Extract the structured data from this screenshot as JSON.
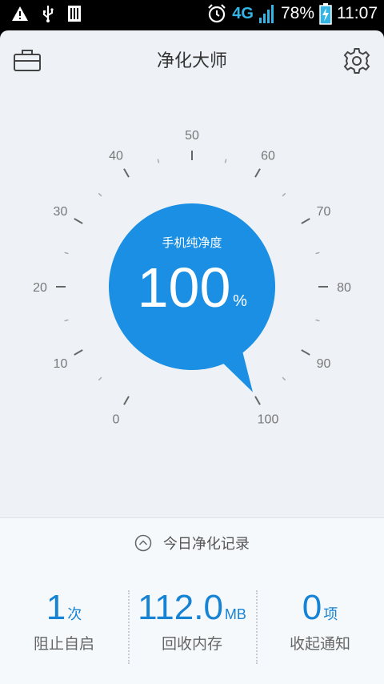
{
  "status_bar": {
    "network": "4G",
    "battery": "78%",
    "time": "11:07",
    "icons": [
      "warning-icon",
      "usb-icon",
      "sim-card-icon",
      "alarm-icon",
      "signal-icon",
      "battery-charging-icon"
    ]
  },
  "header": {
    "title": "净化大师",
    "left_icon": "briefcase-icon",
    "right_icon": "gear-icon"
  },
  "gauge": {
    "ticks": [
      "0",
      "10",
      "20",
      "30",
      "40",
      "50",
      "60",
      "70",
      "80",
      "90",
      "100"
    ],
    "label": "手机纯净度",
    "value": "100",
    "unit": "%",
    "level": 100,
    "accent": "#1a8fe3"
  },
  "today": {
    "label": "今日净化记录",
    "icon": "chevron-up-circle-icon"
  },
  "stats": [
    {
      "value": "1",
      "unit": "次",
      "label": "阻止自启"
    },
    {
      "value": "112.0",
      "unit": "MB",
      "label": "回收内存"
    },
    {
      "value": "0",
      "unit": "项",
      "label": "收起通知"
    }
  ]
}
